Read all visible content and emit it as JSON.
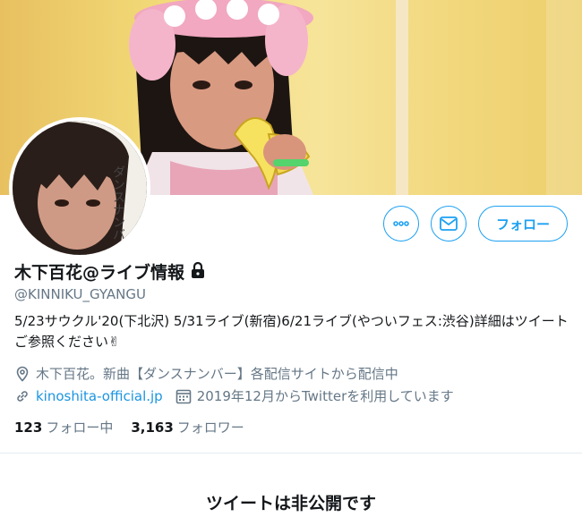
{
  "profile": {
    "display_name": "木下百花@ライブ情報",
    "handle": "@KINNIKU_GYANGU",
    "bio": "5/23サウクル'20(下北沢) 5/31ライブ(新宿)6/21ライブ(やついフェス:渋谷)詳細はツイートご参照ください✌",
    "location": "木下百花。新曲【ダンスナンバー】各配信サイトから配信中",
    "website": "kinoshita-official.jp",
    "joined": "2019年12月からTwitterを利用しています",
    "avatar_text": "ダンスナンバー"
  },
  "actions": {
    "more_icon": "more-icon",
    "message_icon": "envelope-icon",
    "follow_label": "フォロー"
  },
  "counts": {
    "following_num": "123",
    "following_label": "フォロー中",
    "followers_num": "3,163",
    "followers_label": "フォロワー"
  },
  "timeline": {
    "private_message": "ツイートは非公開です"
  },
  "colors": {
    "accent": "#1da1f2",
    "link": "#1b95e0",
    "secondary_text": "#657786"
  }
}
